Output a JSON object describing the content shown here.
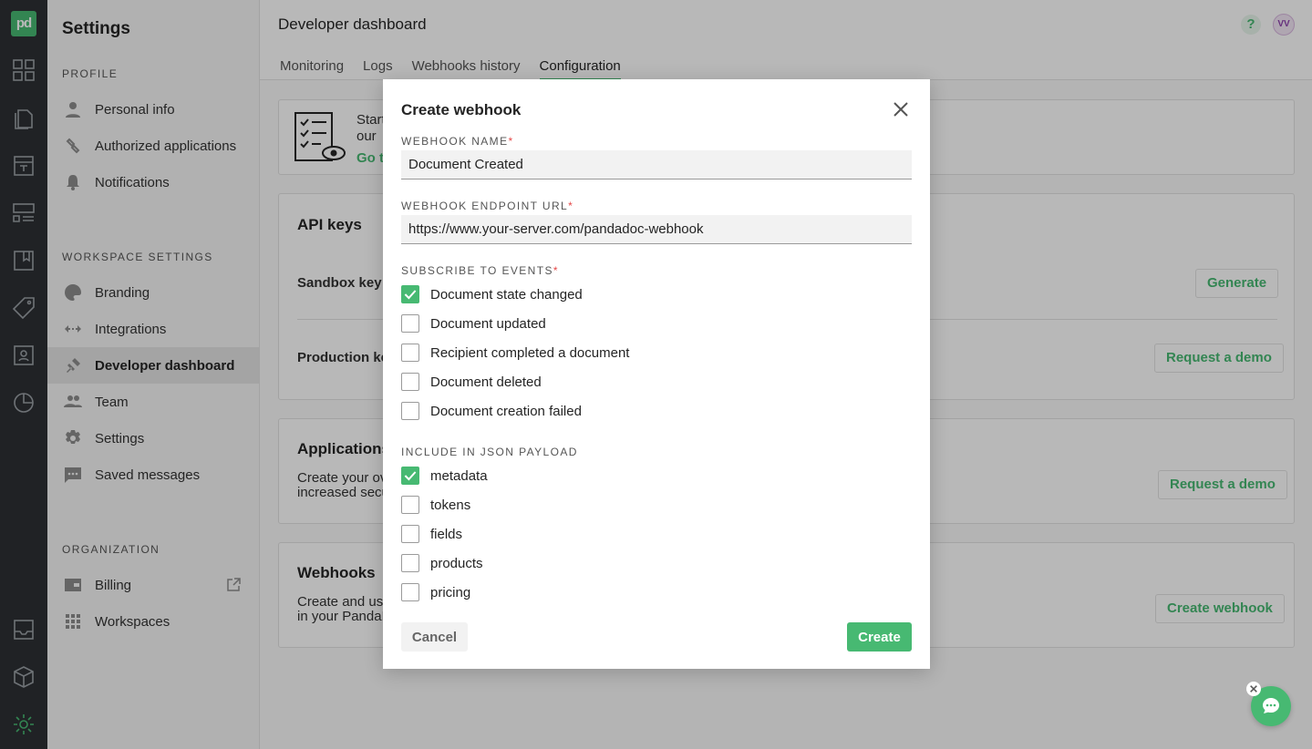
{
  "app": {
    "logo_text": "pd",
    "brand_color": "#47b972"
  },
  "rail": {
    "icons": [
      "dashboard-icon",
      "documents-icon",
      "templates-icon",
      "content-library-icon",
      "catalog-icon",
      "tag-icon",
      "contacts-icon",
      "reports-icon",
      "inbox-icon",
      "integrations-cube-icon",
      "settings-gear-icon"
    ]
  },
  "sidebar": {
    "title": "Settings",
    "profile_section": "PROFILE",
    "profile_items": [
      {
        "label": "Personal info",
        "icon": "person-icon"
      },
      {
        "label": "Authorized applications",
        "icon": "link-icon"
      },
      {
        "label": "Notifications",
        "icon": "bell-icon"
      }
    ],
    "workspace_section": "WORKSPACE SETTINGS",
    "workspace_items": [
      {
        "label": "Branding",
        "icon": "palette-icon"
      },
      {
        "label": "Integrations",
        "icon": "arrows-icon"
      },
      {
        "label": "Developer dashboard",
        "icon": "plug-icon"
      },
      {
        "label": "Team",
        "icon": "team-icon"
      },
      {
        "label": "Settings",
        "icon": "gear-icon"
      },
      {
        "label": "Saved messages",
        "icon": "message-icon"
      }
    ],
    "org_section": "ORGANIZATION",
    "org_items": [
      {
        "label": "Billing",
        "icon": "wallet-icon"
      },
      {
        "label": "Workspaces",
        "icon": "grid-icon"
      }
    ]
  },
  "header": {
    "title": "Developer dashboard",
    "help": "?",
    "avatar": "VV",
    "tabs": [
      "Monitoring",
      "Logs",
      "Webhooks history",
      "Configuration"
    ],
    "active_tab": "Configuration"
  },
  "cards": {
    "intro": {
      "text_line1": "Start",
      "text_line2": "our",
      "link": "Go to"
    },
    "api_keys": {
      "title": "API keys",
      "sandbox_label": "Sandbox key",
      "sandbox_button": "Generate",
      "production_label": "Production ke",
      "production_button": "Request a demo"
    },
    "applications": {
      "title": "Applications",
      "line1": "Create your ov",
      "line2": "increased secu",
      "button": "Request a demo"
    },
    "webhooks": {
      "title": "Webhooks",
      "line1": "Create and use",
      "line2": "in your PandaD",
      "button": "Create webhook"
    }
  },
  "modal": {
    "title": "Create webhook",
    "name_label": "WEBHOOK NAME",
    "name_value": "Document Created",
    "url_label": "WEBHOOK ENDPOINT URL",
    "url_value": "https://www.your-server.com/pandadoc-webhook",
    "required_mark": "*",
    "events_label": "SUBSCRIBE TO EVENTS",
    "events": [
      {
        "label": "Document state changed",
        "checked": true
      },
      {
        "label": "Document updated",
        "checked": false
      },
      {
        "label": "Recipient completed a document",
        "checked": false
      },
      {
        "label": "Document deleted",
        "checked": false
      },
      {
        "label": "Document creation failed",
        "checked": false
      }
    ],
    "payload_label": "INCLUDE IN JSON PAYLOAD",
    "payload": [
      {
        "label": "metadata",
        "checked": true
      },
      {
        "label": "tokens",
        "checked": false
      },
      {
        "label": "fields",
        "checked": false
      },
      {
        "label": "products",
        "checked": false
      },
      {
        "label": "pricing",
        "checked": false
      }
    ],
    "cancel": "Cancel",
    "create": "Create"
  }
}
